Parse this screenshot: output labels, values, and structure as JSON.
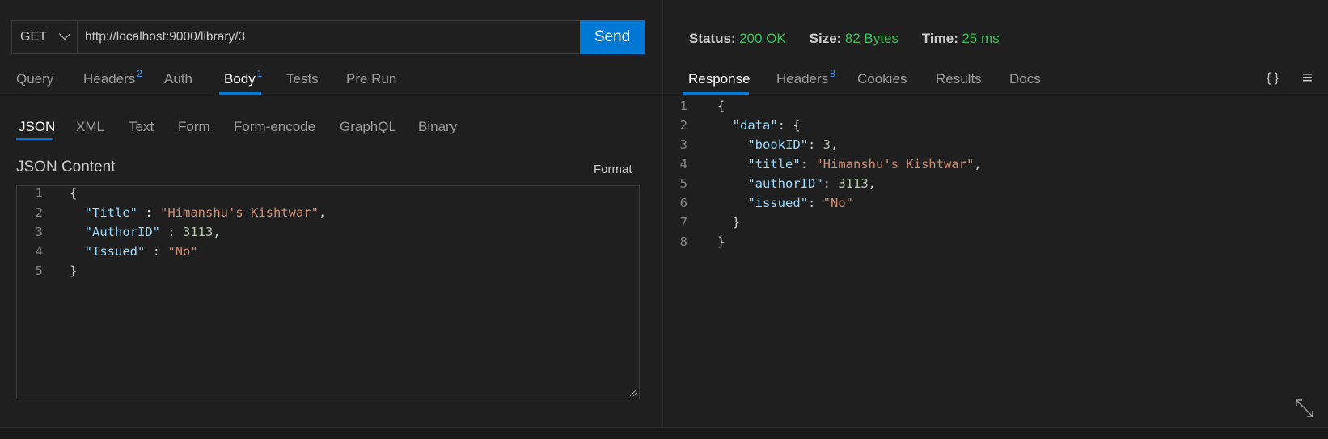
{
  "request": {
    "method": "GET",
    "url": "http://localhost:9000/library/3",
    "send_label": "Send"
  },
  "request_tabs": [
    {
      "label": "Query",
      "badge": ""
    },
    {
      "label": "Headers",
      "badge": "2"
    },
    {
      "label": "Auth",
      "badge": ""
    },
    {
      "label": "Body",
      "badge": "1"
    },
    {
      "label": "Tests",
      "badge": ""
    },
    {
      "label": "Pre Run",
      "badge": ""
    }
  ],
  "body_tabs": [
    "JSON",
    "XML",
    "Text",
    "Form",
    "Form-encode",
    "GraphQL",
    "Binary"
  ],
  "json_content": {
    "title": "JSON Content",
    "format_label": "Format",
    "lines": [
      {
        "n": "1",
        "text": "{"
      },
      {
        "n": "2",
        "text": "  \"Title\" : \"Himanshu's Kishtwar\","
      },
      {
        "n": "3",
        "text": "  \"AuthorID\" : 3113,"
      },
      {
        "n": "4",
        "text": "  \"Issued\" : \"No\""
      },
      {
        "n": "5",
        "text": "}"
      }
    ]
  },
  "status": {
    "status_label": "Status:",
    "status_value": "200 OK",
    "size_label": "Size:",
    "size_value": "82 Bytes",
    "time_label": "Time:",
    "time_value": "25 ms"
  },
  "response_tabs": [
    {
      "label": "Response",
      "badge": ""
    },
    {
      "label": "Headers",
      "badge": "8"
    },
    {
      "label": "Cookies",
      "badge": ""
    },
    {
      "label": "Results",
      "badge": ""
    },
    {
      "label": "Docs",
      "badge": ""
    }
  ],
  "response_icons": {
    "braces": "{ }",
    "menu": "≡"
  },
  "response_body": {
    "lines": [
      {
        "n": "1",
        "text": "{"
      },
      {
        "n": "2",
        "text": "  \"data\": {"
      },
      {
        "n": "3",
        "text": "    \"bookID\": 3,"
      },
      {
        "n": "4",
        "text": "    \"title\": \"Himanshu's Kishtwar\","
      },
      {
        "n": "5",
        "text": "    \"authorID\": 3113,"
      },
      {
        "n": "6",
        "text": "    \"issued\": \"No\""
      },
      {
        "n": "7",
        "text": "  }"
      },
      {
        "n": "8",
        "text": "}"
      }
    ]
  },
  "colors": {
    "accent": "#0078d4",
    "status_green": "#3cbf5a",
    "badge_blue": "#3794ff"
  }
}
